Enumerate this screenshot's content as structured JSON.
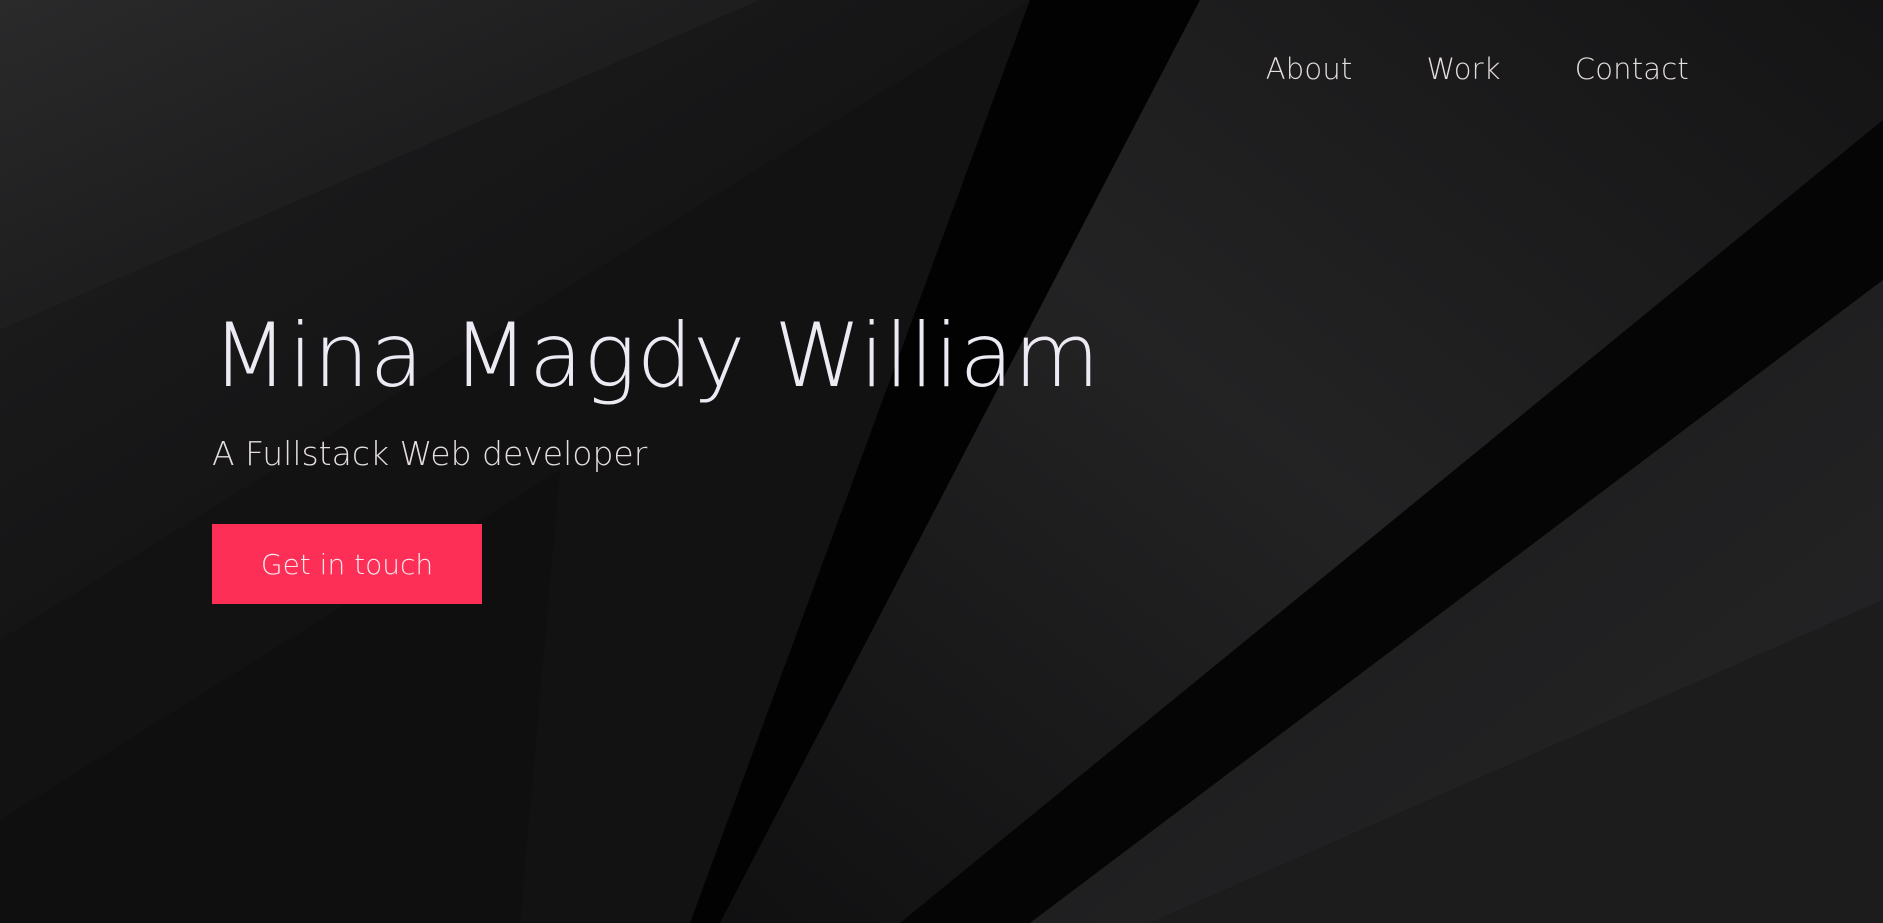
{
  "nav": {
    "items": [
      {
        "label": "About"
      },
      {
        "label": "Work"
      },
      {
        "label": "Contact"
      }
    ]
  },
  "hero": {
    "name": "Mina Magdy William",
    "subtitle": "A Fullstack Web developer",
    "cta_label": "Get in touch"
  },
  "colors": {
    "background": "#0e0e0f",
    "accent": "#fd2f57",
    "text_primary": "#eeeaf3",
    "text_secondary": "#e6dede"
  }
}
